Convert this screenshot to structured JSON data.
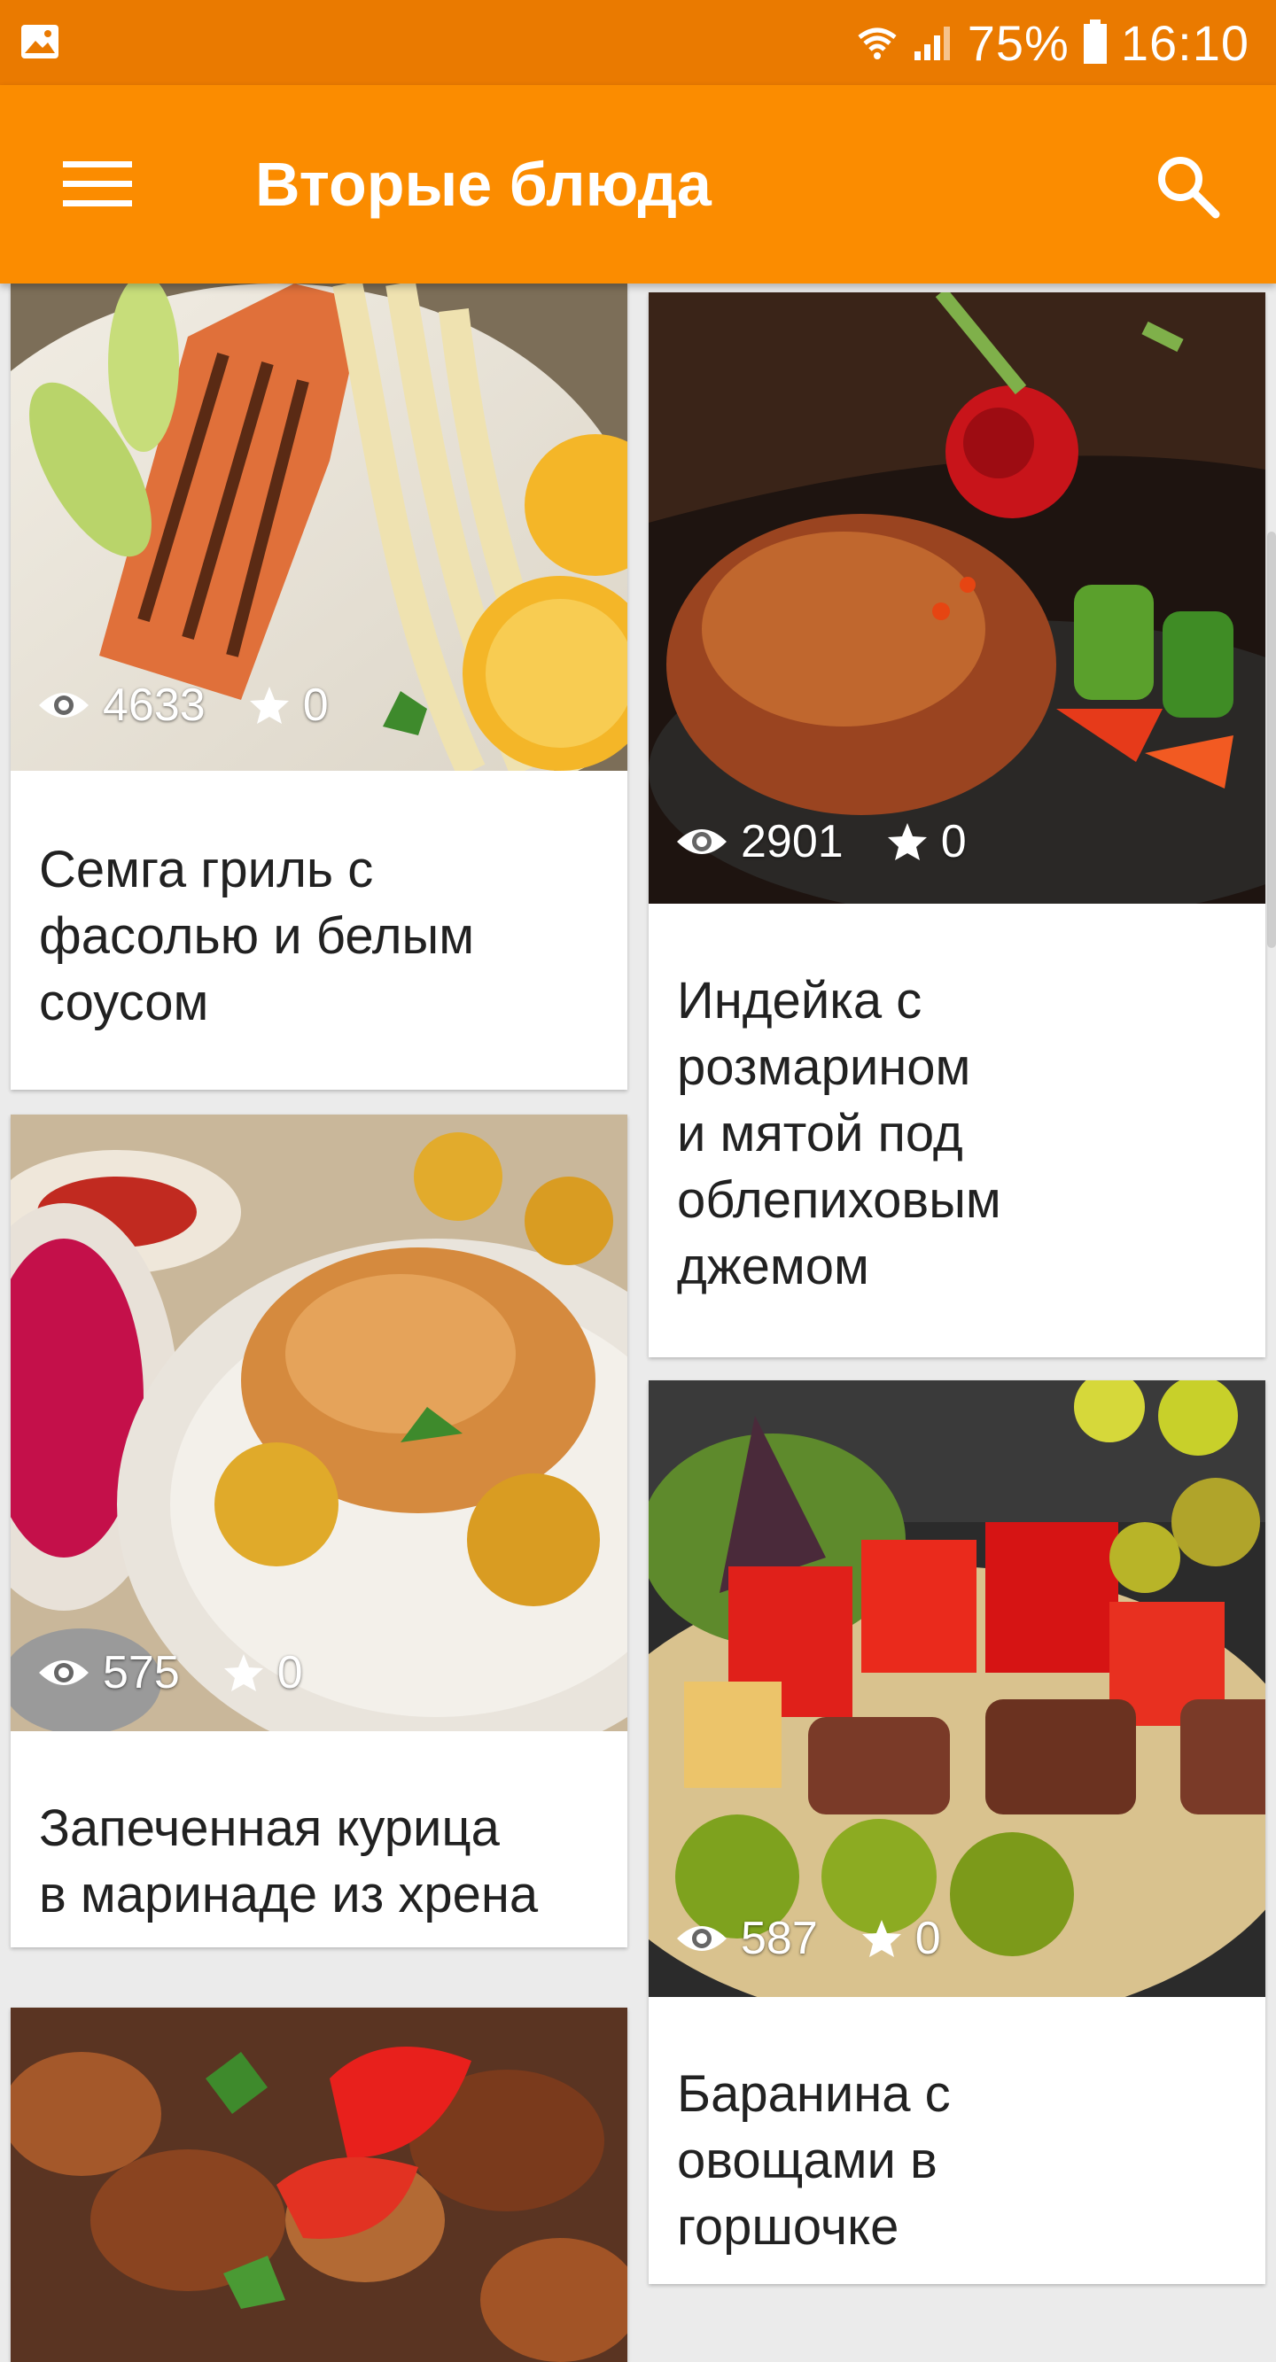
{
  "status_bar": {
    "battery": "75%",
    "time": "16:10",
    "icons": [
      "gallery-icon",
      "wifi-icon",
      "signal-icon",
      "battery-icon"
    ]
  },
  "app_bar": {
    "title": "Вторые блюда",
    "icons": [
      "menu-icon",
      "search-icon"
    ]
  },
  "recipes": [
    {
      "title": "Семга гриль с\nфасолью и белым\nсоусом",
      "views": "4633",
      "rating": "0"
    },
    {
      "title": "Индейка с\nрозмарином\nи мятой под\nоблепиховым\nджемом",
      "views": "2901",
      "rating": "0"
    },
    {
      "title": "Запеченная курица\nв маринаде из хрена",
      "views": "575",
      "rating": "0"
    },
    {
      "title": "Баранина с\nовощами в\nгоршочке",
      "views": "587",
      "rating": "0"
    },
    {
      "title": "",
      "views": "",
      "rating": ""
    }
  ],
  "colors": {
    "status_bar": "#ea7a00",
    "app_bar": "#fb8c00",
    "background": "#ebebeb"
  }
}
